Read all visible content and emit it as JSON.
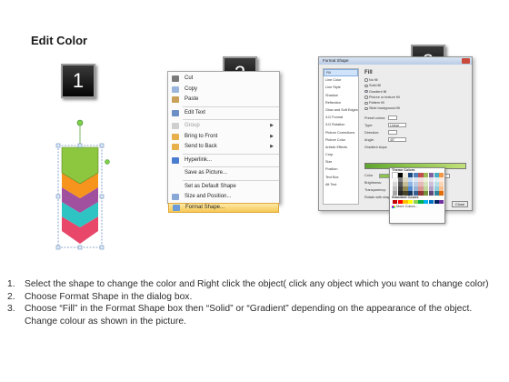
{
  "title": "Edit Color",
  "steps": [
    "1",
    "2",
    "3"
  ],
  "context_menu": {
    "items": [
      {
        "label": "Cut",
        "icon": "scissors-icon",
        "disabled": false,
        "submenu": false
      },
      {
        "label": "Copy",
        "icon": "copy-icon",
        "disabled": false,
        "submenu": false
      },
      {
        "label": "Paste",
        "icon": "paste-icon",
        "disabled": false,
        "submenu": false
      },
      {
        "label": "Edit Text",
        "icon": "edit-text-icon",
        "disabled": false,
        "submenu": false
      },
      {
        "label": "Group",
        "icon": "group-icon",
        "disabled": true,
        "submenu": true
      },
      {
        "label": "Bring to Front",
        "icon": "bring-front-icon",
        "disabled": false,
        "submenu": true
      },
      {
        "label": "Send to Back",
        "icon": "send-back-icon",
        "disabled": false,
        "submenu": true
      },
      {
        "label": "Hyperlink...",
        "icon": "hyperlink-icon",
        "disabled": false,
        "submenu": false
      },
      {
        "label": "Save as Picture...",
        "icon": "",
        "disabled": false,
        "submenu": false
      },
      {
        "label": "Set as Default Shape",
        "icon": "",
        "disabled": false,
        "submenu": false
      },
      {
        "label": "Size and Position...",
        "icon": "size-position-icon",
        "disabled": false,
        "submenu": false
      },
      {
        "label": "Format Shape...",
        "icon": "format-shape-icon",
        "disabled": false,
        "submenu": false,
        "highlighted": true
      }
    ]
  },
  "format_dialog": {
    "title": "Format Shape",
    "nav": [
      "Fill",
      "Line Color",
      "Line Style",
      "Shadow",
      "Reflection",
      "Glow and Soft Edges",
      "3-D Format",
      "3-D Rotation",
      "Picture Corrections",
      "Picture Color",
      "Artistic Effects",
      "Crop",
      "Size",
      "Position",
      "Text Box",
      "Alt Text"
    ],
    "fill_heading": "Fill",
    "fill_options": [
      "No fill",
      "Solid fill",
      "Gradient fill",
      "Picture or texture fill",
      "Pattern fill",
      "Slide background fill"
    ],
    "selected_fill": "Gradient fill",
    "props": [
      "Preset colors:",
      "Type:",
      "Direction:",
      "Angle:"
    ],
    "prop_values": [
      "",
      "Linear",
      "",
      "45°"
    ],
    "gradient_stops_label": "Gradient stops",
    "color_label": "Color",
    "position_label": "Position:",
    "position_value": "0%",
    "brightness_label": "Brightness:",
    "transparency_label": "Transparency:",
    "rotate_label": "Rotate with shape",
    "close_button": "Close",
    "theme_colors_label": "Theme Colors",
    "standard_colors_label": "Standard Colors",
    "more_colors_label": "More Colors...",
    "theme_top_row": [
      "#ffffff",
      "#000000",
      "#eeece1",
      "#1f497d",
      "#4f81bd",
      "#c0504d",
      "#9bbb59",
      "#8064a2",
      "#4bacc6",
      "#f79646"
    ],
    "standard_colors": [
      "#c00000",
      "#ff0000",
      "#ffc000",
      "#ffff00",
      "#92d050",
      "#00b050",
      "#00b0f0",
      "#0070c0",
      "#002060",
      "#7030a0"
    ]
  },
  "shape_colors": [
    "#8dc63f",
    "#f7941d",
    "#a0509e",
    "#2ec4c4",
    "#e8476a"
  ],
  "instructions": [
    {
      "num": "1.",
      "text": "Select the shape to change the color and Right click the object( click any object which you want to change color)"
    },
    {
      "num": "2.",
      "text": "Choose Format Shape in the dialog box."
    },
    {
      "num": "3.",
      "text": "Choose “Fill” in the Format Shape box then “Solid” or “Gradient” depending on the appearance of the object. Change colour as shown in the picture."
    }
  ]
}
